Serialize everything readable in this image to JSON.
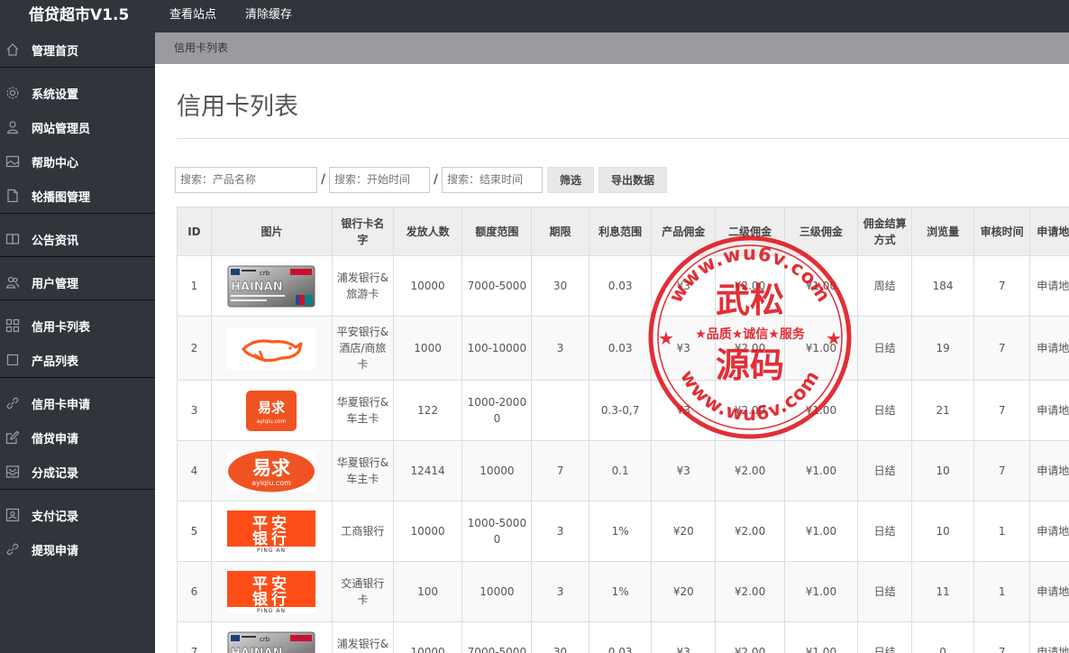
{
  "app": {
    "title": "借贷超市V1.5"
  },
  "top_links": [
    "查看站点",
    "清除缓存"
  ],
  "sidebar": {
    "items": [
      {
        "label": "管理首页",
        "icon": "home-icon"
      },
      {
        "label": "系统设置",
        "icon": "gear-icon"
      },
      {
        "label": "网站管理员",
        "icon": "user-icon"
      },
      {
        "label": "帮助中心",
        "icon": "picture-icon"
      },
      {
        "label": "轮播图管理",
        "icon": "document-icon"
      },
      {
        "label": "公告资讯",
        "icon": "book-icon"
      },
      {
        "label": "用户管理",
        "icon": "users-icon"
      },
      {
        "label": "信用卡列表",
        "icon": "grid-icon"
      },
      {
        "label": "产品列表",
        "icon": "square-icon"
      },
      {
        "label": "信用卡申请",
        "icon": "link-icon"
      },
      {
        "label": "借贷申请",
        "icon": "edit-icon"
      },
      {
        "label": "分成记录",
        "icon": "inbox-icon"
      },
      {
        "label": "支付记录",
        "icon": "id-card-icon"
      },
      {
        "label": "提现申请",
        "icon": "link-icon"
      }
    ]
  },
  "breadcrumb": "信用卡列表",
  "page_title": "信用卡列表",
  "filters": {
    "product_placeholder": "搜索：产品名称",
    "start_placeholder": "搜索：开始时间",
    "end_placeholder": "搜索：结束时间",
    "slash": "/",
    "filter_button": "筛选",
    "export_button": "导出数据"
  },
  "table": {
    "headers": [
      "ID",
      "图片",
      "银行卡名字",
      "发放人数",
      "额度范围",
      "期限",
      "利息范围",
      "产品佣金",
      "二级佣金",
      "三级佣金",
      "佣金结算方式",
      "浏览量",
      "审核时间",
      "申请地址"
    ],
    "rows": [
      {
        "id": "1",
        "image": "hainan-card",
        "name": "浦发银行&旅游卡",
        "count": "10000",
        "range": "7000-5000",
        "term": "30",
        "interest": "0.03",
        "commission": "¥3",
        "second": "¥2.00",
        "third": "¥1.00",
        "settle": "周结",
        "views": "184",
        "audit": "7",
        "link": "申请地址"
      },
      {
        "id": "2",
        "image": "fox-logo",
        "name": "平安银行&酒店/商旅卡",
        "count": "1000",
        "range": "100-10000",
        "term": "3",
        "interest": "0.03",
        "commission": "¥3",
        "second": "¥2.00",
        "third": "¥1.00",
        "settle": "日结",
        "views": "19",
        "audit": "7",
        "link": "申请地址"
      },
      {
        "id": "3",
        "image": "yiqiu-small",
        "name": "华夏银行&车主卡",
        "count": "122",
        "range": "1000-20000",
        "term": "",
        "interest": "0.3-0,7",
        "commission": "¥3",
        "second": "¥2.00",
        "third": "¥1.00",
        "settle": "日结",
        "views": "21",
        "audit": "7",
        "link": "申请地址"
      },
      {
        "id": "4",
        "image": "yiqiu-large",
        "name": "华夏银行&车主卡",
        "count": "12414",
        "range": "10000",
        "term": "7",
        "interest": "0.1",
        "commission": "¥3",
        "second": "¥2.00",
        "third": "¥1.00",
        "settle": "日结",
        "views": "10",
        "audit": "7",
        "link": "申请地址"
      },
      {
        "id": "5",
        "image": "pingan-bank",
        "name": "工商银行",
        "count": "10000",
        "range": "1000-50000",
        "term": "3",
        "interest": "1%",
        "commission": "¥20",
        "second": "¥2.00",
        "third": "¥1.00",
        "settle": "日结",
        "views": "10",
        "audit": "1",
        "link": "申请地址"
      },
      {
        "id": "6",
        "image": "pingan-bank",
        "name": "交通银行卡",
        "count": "100",
        "range": "10000",
        "term": "3",
        "interest": "1%",
        "commission": "¥20",
        "second": "¥2.00",
        "third": "¥1.00",
        "settle": "日结",
        "views": "11",
        "audit": "1",
        "link": "申请地址"
      },
      {
        "id": "7",
        "image": "hainan-card",
        "name": "浦发银行&旅游卡",
        "count": "10000",
        "range": "7000-5000",
        "term": "30",
        "interest": "0.03",
        "commission": "¥3",
        "second": "¥2.00",
        "third": "¥1.00",
        "settle": "日结",
        "views": "0",
        "audit": "7",
        "link": "申请地址"
      }
    ]
  },
  "images": {
    "hainan_text": "HAINAN",
    "cib_text": "crb",
    "yiqiu_cn": "易求",
    "yiqiu_en": "ayiqiu.com",
    "pingan_line1": "平安",
    "pingan_line2": "银行",
    "pingan_en": "PING AN"
  },
  "watermark": {
    "url_top": "www.wu6v.com",
    "url_bottom": "www.wu6v.com",
    "line1": "武松",
    "motto": "★品质★诚信★服务",
    "line2": "源码"
  },
  "colors": {
    "sidebar_bg": "#2f353b",
    "breadcrumb_bg": "#999b9e",
    "header_bg": "#eeeeee",
    "stamp_red": "#e0131b",
    "pingan_orange": "#ff4d17",
    "yiqiu_orange": "#f05322"
  }
}
